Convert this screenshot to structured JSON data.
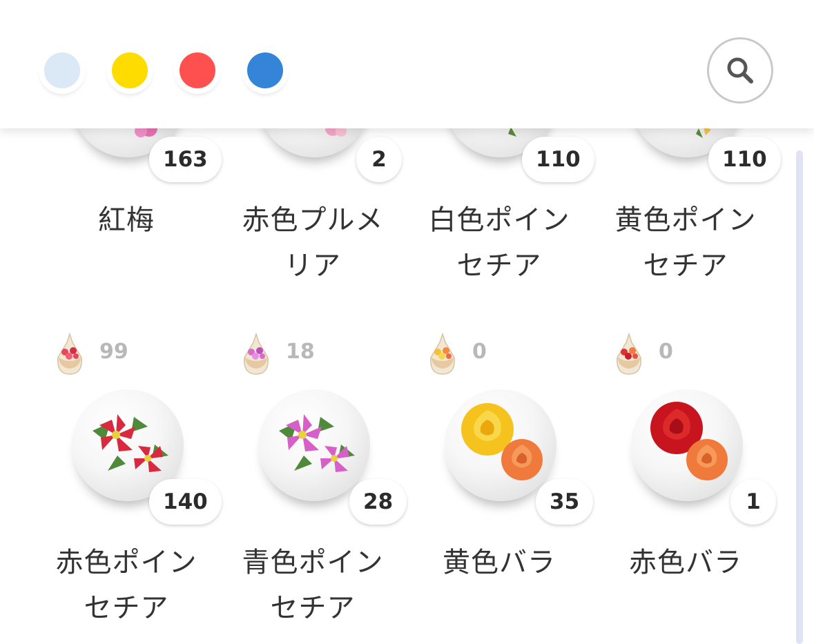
{
  "header": {
    "color_filters": [
      {
        "name": "white",
        "color": "#dbe9f7"
      },
      {
        "name": "yellow",
        "color": "#ffdc00"
      },
      {
        "name": "red",
        "color": "#ff5050"
      },
      {
        "name": "blue",
        "color": "#3484d8"
      }
    ],
    "search_icon": "search-icon"
  },
  "row1": [
    {
      "name": "紅梅",
      "count": "163"
    },
    {
      "name": "赤色プルメリア",
      "count": "2"
    },
    {
      "name": "白色ポインセチア",
      "count": "110"
    },
    {
      "name": "黄色ポインセチア",
      "count": "110"
    }
  ],
  "row2": [
    {
      "name": "赤色ポインセチア",
      "count": "140",
      "stock": "99"
    },
    {
      "name": "青色ポインセチア",
      "count": "28",
      "stock": "18"
    },
    {
      "name": "黄色バラ",
      "count": "35",
      "stock": "0"
    },
    {
      "name": "赤色バラ",
      "count": "1",
      "stock": "0"
    }
  ]
}
